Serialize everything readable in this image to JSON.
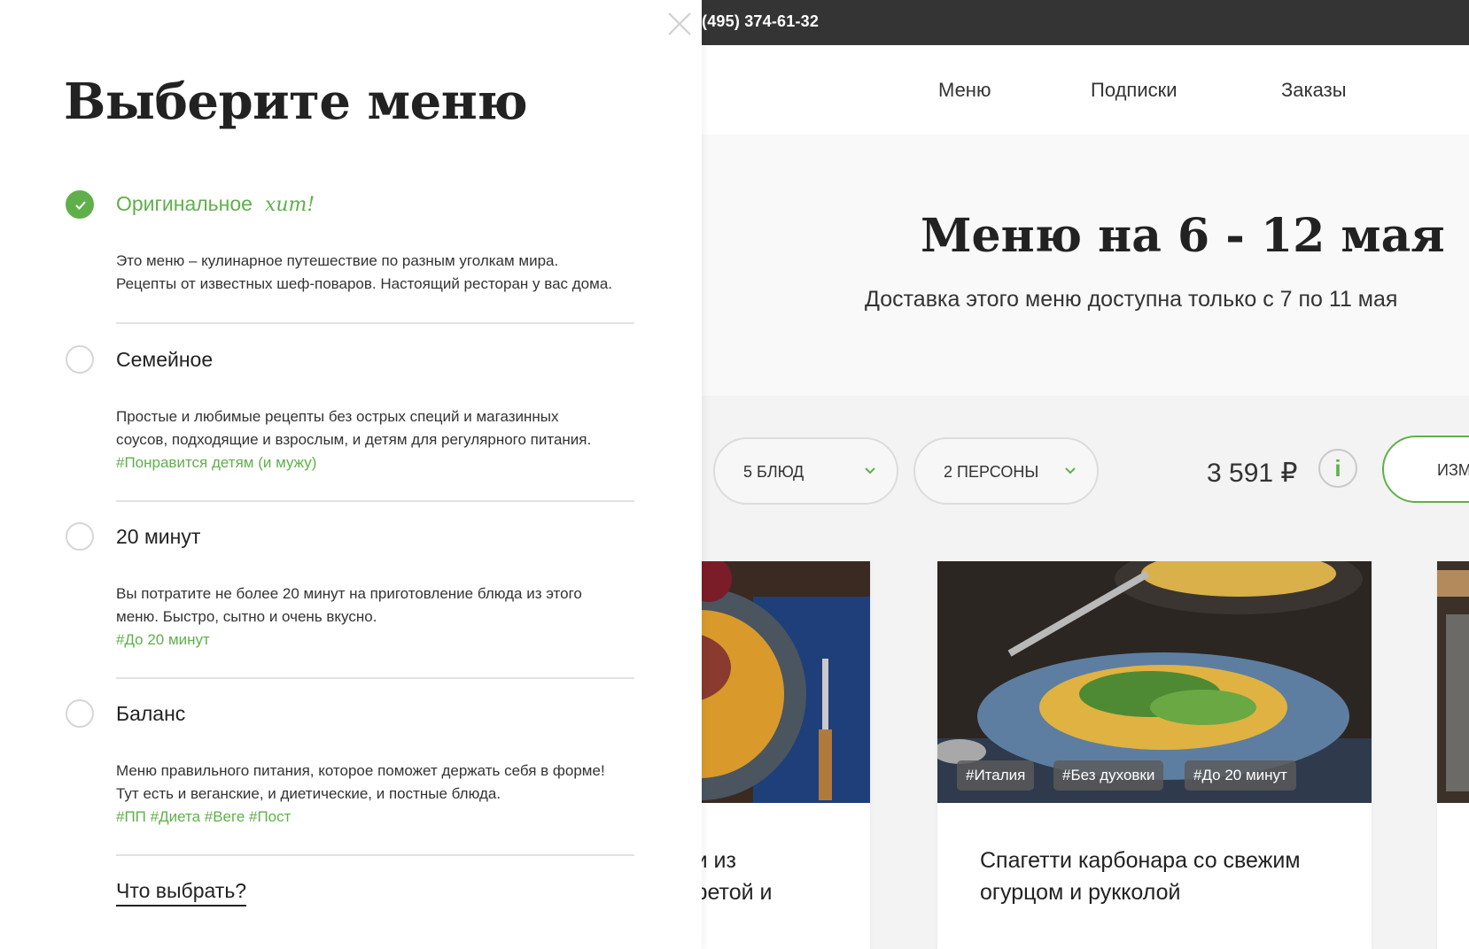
{
  "topbar": {
    "phone": "(495) 374-61-32"
  },
  "nav": {
    "items": [
      "Меню",
      "Подписки",
      "Заказы"
    ]
  },
  "hero": {
    "title": "Меню на 6 - 12 мая",
    "subtitle": "Доставка этого меню доступна только с 7 по 11 мая"
  },
  "filters": {
    "dishes": "5 БЛЮД",
    "persons": "2 ПЕРСОНЫ",
    "price": "3 591 ₽",
    "info_icon": "i",
    "change_label": "ИЗМ"
  },
  "cards": [
    {
      "title_partial_line1": "фи из",
      "title_partial_line2": ", фетой и"
    },
    {
      "title": "Спагетти карбонара со свежим огурцом и рукколой",
      "tags": [
        "#Италия",
        "#Без духовки",
        "#До 20 минут"
      ]
    }
  ],
  "panel": {
    "title": "Выберите меню",
    "options": [
      {
        "name": "Оригинальное",
        "badge": "хит!",
        "selected": true,
        "desc_line1": "Это меню – кулинарное путешествие по разным уголкам мира.",
        "desc_line2": "Рецепты от известных шеф-поваров. Настоящий ресторан у вас дома.",
        "tags": ""
      },
      {
        "name": "Семейное",
        "selected": false,
        "desc_line1": "Простые и любимые рецепты без острых специй и магазинных",
        "desc_line2": "соусов, подходящие и взрослым, и детям для регулярного питания.",
        "tags": "#Понравится детям (и мужу)"
      },
      {
        "name": "20 минут",
        "selected": false,
        "desc_line1": "Вы потратите не более 20 минут на приготовление блюда из этого",
        "desc_line2": "меню. Быстро, сытно и очень вкусно.",
        "tags": "#До 20 минут"
      },
      {
        "name": "Баланс",
        "selected": false,
        "desc_line1": "Меню правильного питания, которое поможет держать себя в форме!",
        "desc_line2": "Тут есть и веганские, и диетические, и постные блюда.",
        "tags": "#ПП #Диета #Веге #Пост"
      }
    ],
    "help_link": "Что выбрать?"
  },
  "colors": {
    "accent": "#5fb04a",
    "topbar": "#343434",
    "text": "#222222"
  }
}
